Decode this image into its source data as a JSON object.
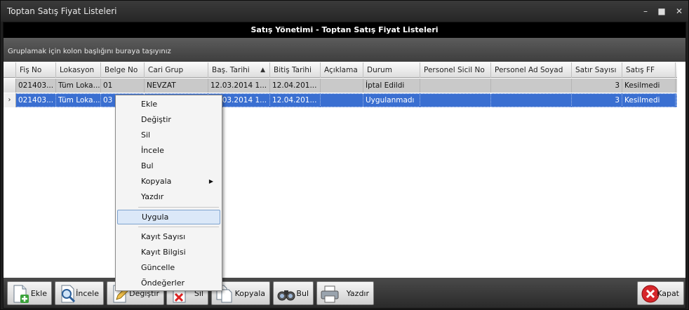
{
  "window": {
    "title": "Toptan Satış Fiyat Listeleri"
  },
  "header": {
    "title": "Satış Yönetimi - Toptan Satış Fiyat Listeleri"
  },
  "group_panel": {
    "hint": "Gruplamak için kolon başlığını buraya taşıyınız"
  },
  "grid": {
    "columns": [
      "Fiş No",
      "Lokasyon",
      "Belge No",
      "Cari Grup",
      "Baş. Tarihi",
      "Bitiş Tarihi",
      "Açıklama",
      "Durum",
      "Personel Sicil No",
      "Personel Ad Soyad",
      "Satır Sayısı",
      "Satış FF"
    ],
    "sorted_column_icon": "sort-ascending-icon",
    "rows": [
      [
        "021403...",
        "Tüm Loka...",
        "01",
        "NEVZAT",
        "12.03.2014 1...",
        "12.04.201...",
        "",
        "İptal Edildi",
        "",
        "",
        "3",
        "Kesilmedi"
      ],
      [
        "021403...",
        "Tüm Loka...",
        "03",
        "",
        "12.03.2014 1...",
        "12.04.201...",
        "",
        "Uygulanmadı",
        "",
        "",
        "3",
        "Kesilmedi"
      ]
    ],
    "selected_row": 1
  },
  "context_menu": {
    "items": [
      {
        "label": "Ekle"
      },
      {
        "label": "Değiştir"
      },
      {
        "label": "Sil"
      },
      {
        "label": "İncele"
      },
      {
        "label": "Bul"
      },
      {
        "label": "Kopyala",
        "submenu": true
      },
      {
        "label": "Yazdır"
      },
      {
        "label": "Uygula",
        "highlighted": true
      },
      {
        "label": "Kayıt Sayısı"
      },
      {
        "label": "Kayıt Bilgisi"
      },
      {
        "label": "Güncelle"
      },
      {
        "label": "Öndeğerler"
      }
    ]
  },
  "toolbar": {
    "ekle": "Ekle",
    "incele": "İncele",
    "degistir": "Değiştir",
    "sil": "Sil",
    "kopyala": "Kopyala",
    "bul": "Bul",
    "yazdir": "Yazdır",
    "kapat": "Kapat"
  },
  "colors": {
    "selected_row": "#3a6fd1",
    "header_band": "#000000",
    "menu_highlight": "#dbe8f8"
  }
}
